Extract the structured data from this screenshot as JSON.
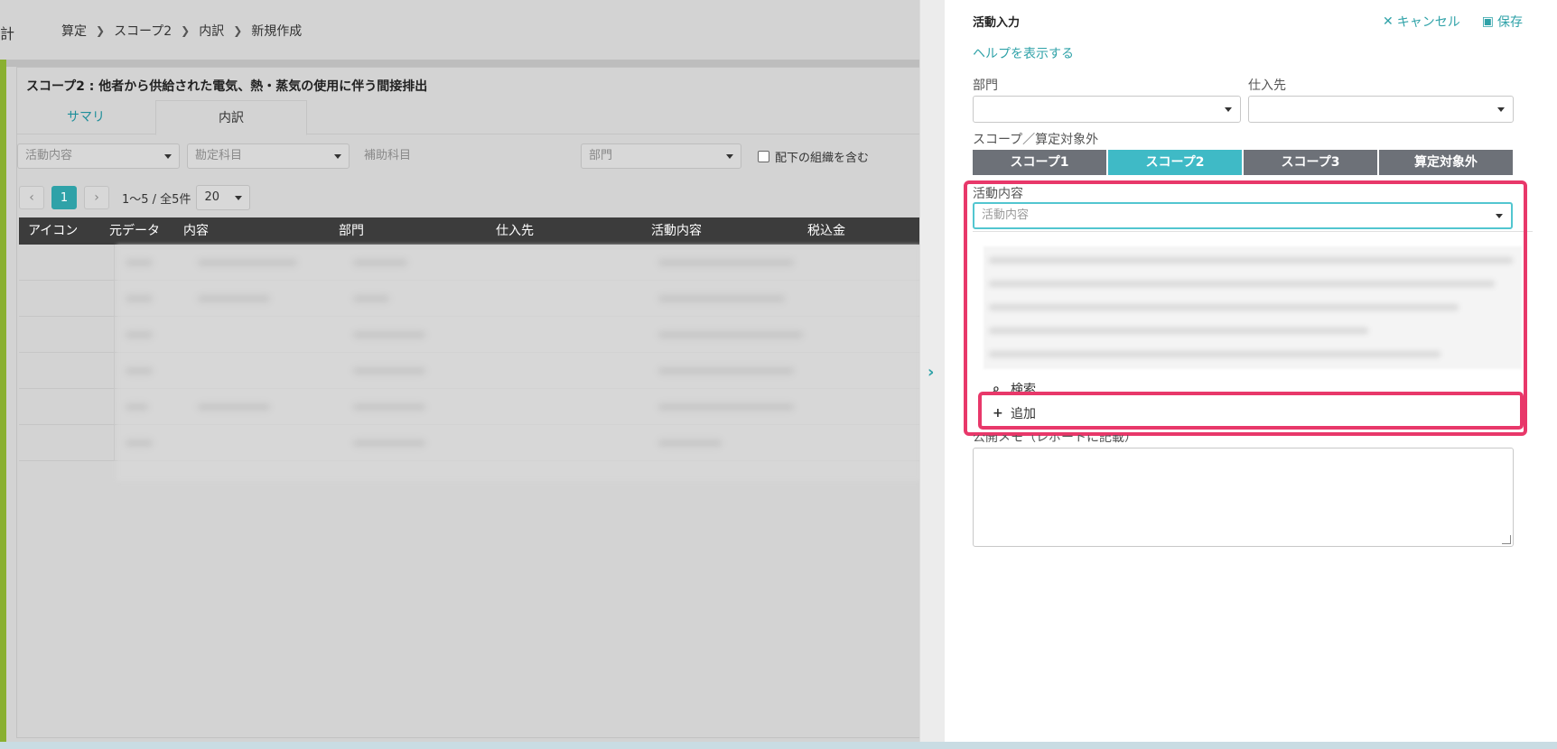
{
  "app": {
    "title_fragment": "計"
  },
  "breadcrumb": [
    "算定",
    "スコープ2",
    "内訳",
    "新規作成"
  ],
  "card": {
    "title": "スコープ2 : 他者から供給された電気、熱・蒸気の使用に伴う間接排出",
    "tabs": [
      {
        "label": "サマリ",
        "active": false
      },
      {
        "label": "内訳",
        "active": true
      }
    ]
  },
  "filters": {
    "activity_placeholder": "活動内容",
    "account_placeholder": "勘定科目",
    "sub_account_label": "補助科目",
    "department_placeholder": "部門",
    "include_sub_org_label": "配下の組織を含む"
  },
  "pager": {
    "prev": "‹",
    "current_page": "1",
    "next": "›",
    "info": "1〜5 / 全5件",
    "page_size": "20"
  },
  "table": {
    "columns": [
      "アイコン",
      "元データ",
      "内容",
      "部門",
      "仕入先",
      "活動内容",
      "税込金"
    ],
    "row_count": 6
  },
  "panel": {
    "toggle_icon": "chevron-right-icon",
    "title": "活動入力",
    "cancel_label": "キャンセル",
    "save_label": "保存",
    "help_link": "ヘルプを表示する",
    "department_label": "部門",
    "supplier_label": "仕入先",
    "scope_label": "スコープ／算定対象外",
    "scope_buttons": [
      {
        "label": "スコープ1",
        "active": false
      },
      {
        "label": "スコープ2",
        "active": true
      },
      {
        "label": "スコープ3",
        "active": false
      },
      {
        "label": "算定対象外",
        "active": false
      }
    ],
    "activity_label": "活動内容",
    "activity_placeholder": "活動内容",
    "dropdown": {
      "search_label": "検索",
      "add_label": "追加"
    },
    "memo_label": "公開メモ（レポートに記載）"
  },
  "colors": {
    "accent_teal": "#2fa2a8",
    "active_scope": "#3fbac6",
    "inactive_scope": "#6d7178",
    "highlight": "#e8386a",
    "side_accent": "#8ab030"
  }
}
